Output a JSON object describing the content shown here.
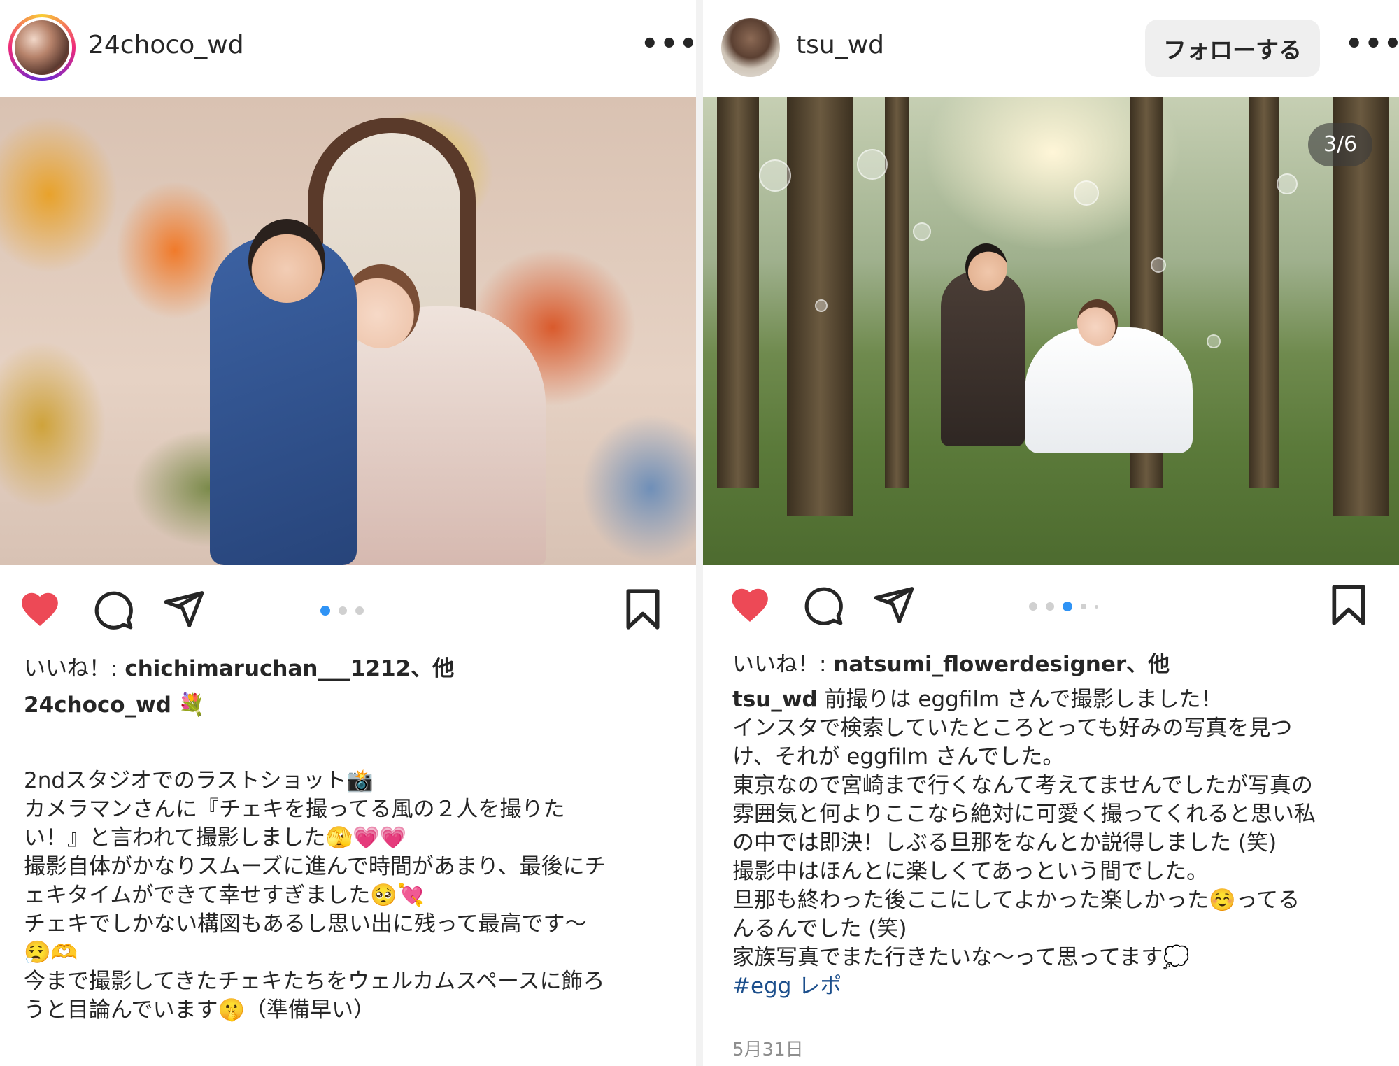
{
  "left_post": {
    "username": "24choco_wd",
    "more_label": "•••",
    "carousel_index": 0,
    "carousel_count": 3,
    "likes_prefix": "いいね！: ",
    "likes_user": "chichimaruchan___1212",
    "likes_suffix": "、他",
    "caption_user": "24choco_wd",
    "caption_user_emoji": "💐",
    "caption_lines": [
      "2ndスタジオでのラストショット📸",
      "カメラマンさんに『チェキを撮ってる風の２人を撮りた",
      "い！』と言われて撮影しました🫣💗💗",
      "撮影自体がかなりスムーズに進んで時間があまり、最後にチ",
      "ェキタイムができて幸せすぎました🥺💘",
      "チェキでしかない構図もあるし思い出に残って最高です〜",
      "😮‍💨🫶",
      "今まで撮影してきたチェキたちをウェルカムスペースに飾ろ",
      "うと目論んでいます🤫（準備早い）"
    ]
  },
  "right_post": {
    "username": "tsu_wd",
    "follow_label": "フォローする",
    "more_label": "•••",
    "photo_counter": "3/6",
    "carousel_index": 2,
    "carousel_count": 6,
    "likes_prefix": "いいね！: ",
    "likes_user": "natsumi_flowerdesigner",
    "likes_suffix": "、他",
    "caption_user": "tsu_wd",
    "caption_first": " 前撮りは eggfilm さんで撮影しました！",
    "caption_lines": [
      "インスタで検索していたところとっても好みの写真を見つ",
      "け、それが eggfilm さんでした。",
      "東京なので宮崎まで行くなんて考えてませんでしたが写真の",
      "雰囲気と何よりここなら絶対に可愛く撮ってくれると思い私",
      "の中では即決！しぶる旦那をなんとか説得しました (笑)",
      "撮影中はほんとに楽しくてあっという間でした。",
      "旦那も終わった後ここにしてよかった楽しかった☺️ってる",
      "んるんでした (笑)",
      "家族写真でまた行きたいな〜って思ってます💭"
    ],
    "hashtag": "#egg レポ",
    "date": "5月31日"
  },
  "colors": {
    "heart": "#ed4956",
    "active_dot": "#2f93f5",
    "hashtag": "#1c4f8c",
    "date": "#8e8e8e"
  },
  "icons": [
    "heart-icon",
    "comment-icon",
    "share-icon",
    "bookmark-icon",
    "more-icon"
  ]
}
